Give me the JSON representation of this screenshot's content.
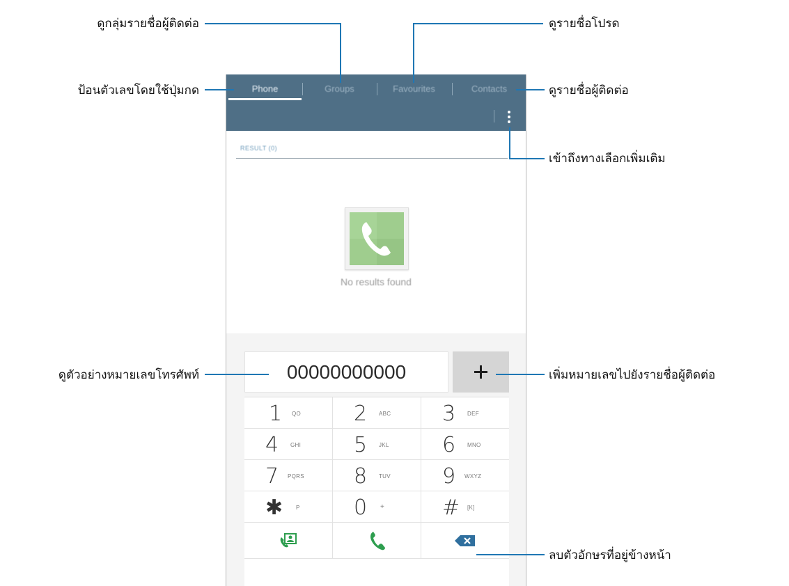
{
  "tabs": [
    {
      "label": "Phone"
    },
    {
      "label": "Groups"
    },
    {
      "label": "Favourites"
    },
    {
      "label": "Contacts"
    }
  ],
  "result": {
    "label": "RESULT (0)"
  },
  "empty_state": {
    "message": "No results found"
  },
  "dialer": {
    "number": "00000000000",
    "keys": [
      {
        "digit": "1",
        "letters": "QO"
      },
      {
        "digit": "2",
        "letters": "ABC"
      },
      {
        "digit": "3",
        "letters": "DEF"
      },
      {
        "digit": "4",
        "letters": "GHI"
      },
      {
        "digit": "5",
        "letters": "JKL"
      },
      {
        "digit": "6",
        "letters": "MNO"
      },
      {
        "digit": "7",
        "letters": "PQRS"
      },
      {
        "digit": "8",
        "letters": "TUV"
      },
      {
        "digit": "9",
        "letters": "WXYZ"
      },
      {
        "digit": "✱",
        "letters": "P"
      },
      {
        "digit": "0",
        "letters": "+"
      },
      {
        "digit": "#",
        "letters": "[K]"
      }
    ]
  },
  "callouts": {
    "groups": "ดูกลุ่มรายชื่อผู้ติดต่อ",
    "favourites": "ดูรายชื่อโปรด",
    "phone": "ป้อนตัวเลขโดยใช้ปุ่มกด",
    "contacts": "ดูรายชื่อผู้ติดต่อ",
    "more_options": "เข้าถึงทางเลือกเพิ่มเติม",
    "number_preview": "ดูตัวอย่างหมายเลขโทรศัพท์",
    "add_to_contacts": "เพิ่มหมายเลขไปยังรายชื่อผู้ติดต่อ",
    "backspace": "ลบตัวอักษรที่อยู่ข้างหน้า"
  },
  "colors": {
    "app_bar": "#4f6f86",
    "callout_line": "#1f77b4",
    "call_green": "#2e9e4f",
    "backspace_blue": "#2f6f9e"
  },
  "icons": [
    "overflow-menu-icon",
    "contact-phone-icon",
    "contacts-icon",
    "call-icon",
    "backspace-icon",
    "add-icon"
  ]
}
